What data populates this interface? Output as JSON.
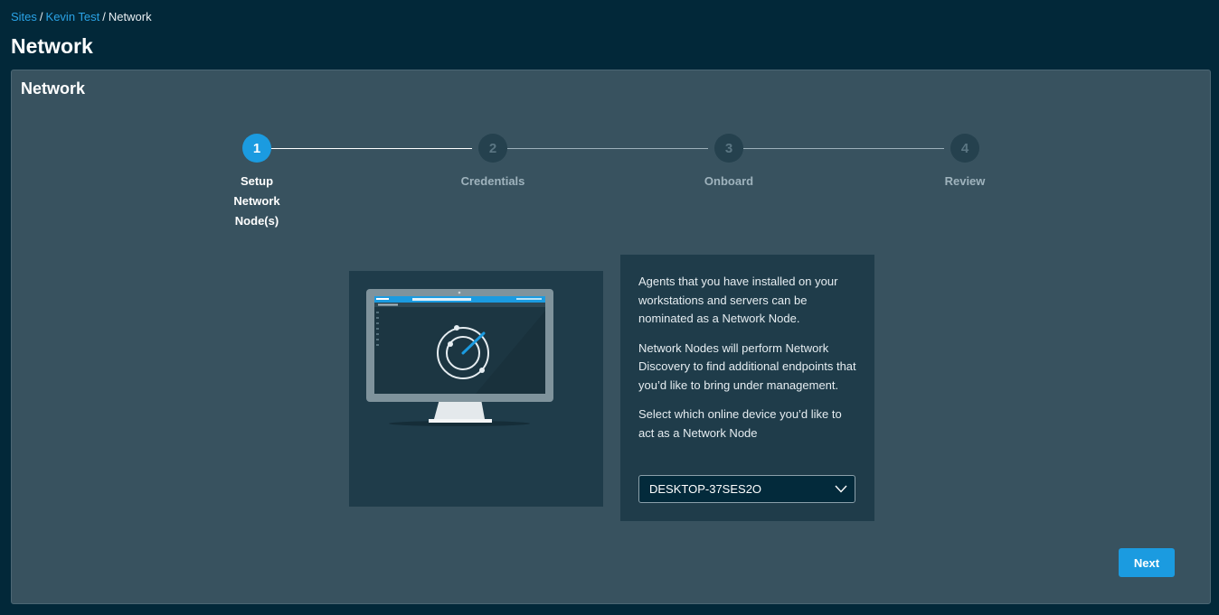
{
  "breadcrumb": {
    "items": [
      "Sites",
      "Kevin Test",
      "Network"
    ]
  },
  "page": {
    "title": "Network"
  },
  "panel": {
    "title": "Network"
  },
  "stepper": {
    "steps": [
      {
        "number": "1",
        "label": "Setup Network Node(s)",
        "active": true
      },
      {
        "number": "2",
        "label": "Credentials",
        "active": false
      },
      {
        "number": "3",
        "label": "Onboard",
        "active": false
      },
      {
        "number": "4",
        "label": "Review",
        "active": false
      }
    ]
  },
  "info": {
    "paragraph1": "Agents that you have installed on your workstations and servers can be nominated as a Network Node.",
    "paragraph2": "Network Nodes will perform Network Discovery to find additional endpoints that you’d like to bring under management.",
    "paragraph3": "Select which online device you’d like to act as a Network Node",
    "device_select": {
      "value": "DESKTOP-37SES2O"
    }
  },
  "actions": {
    "next_label": "Next"
  },
  "colors": {
    "accent": "#1b9be0",
    "background": "#022839",
    "panel": "#38525f"
  },
  "icons": {
    "illustration": "monitor-radar-illustration",
    "dropdown": "chevron-down-icon"
  }
}
